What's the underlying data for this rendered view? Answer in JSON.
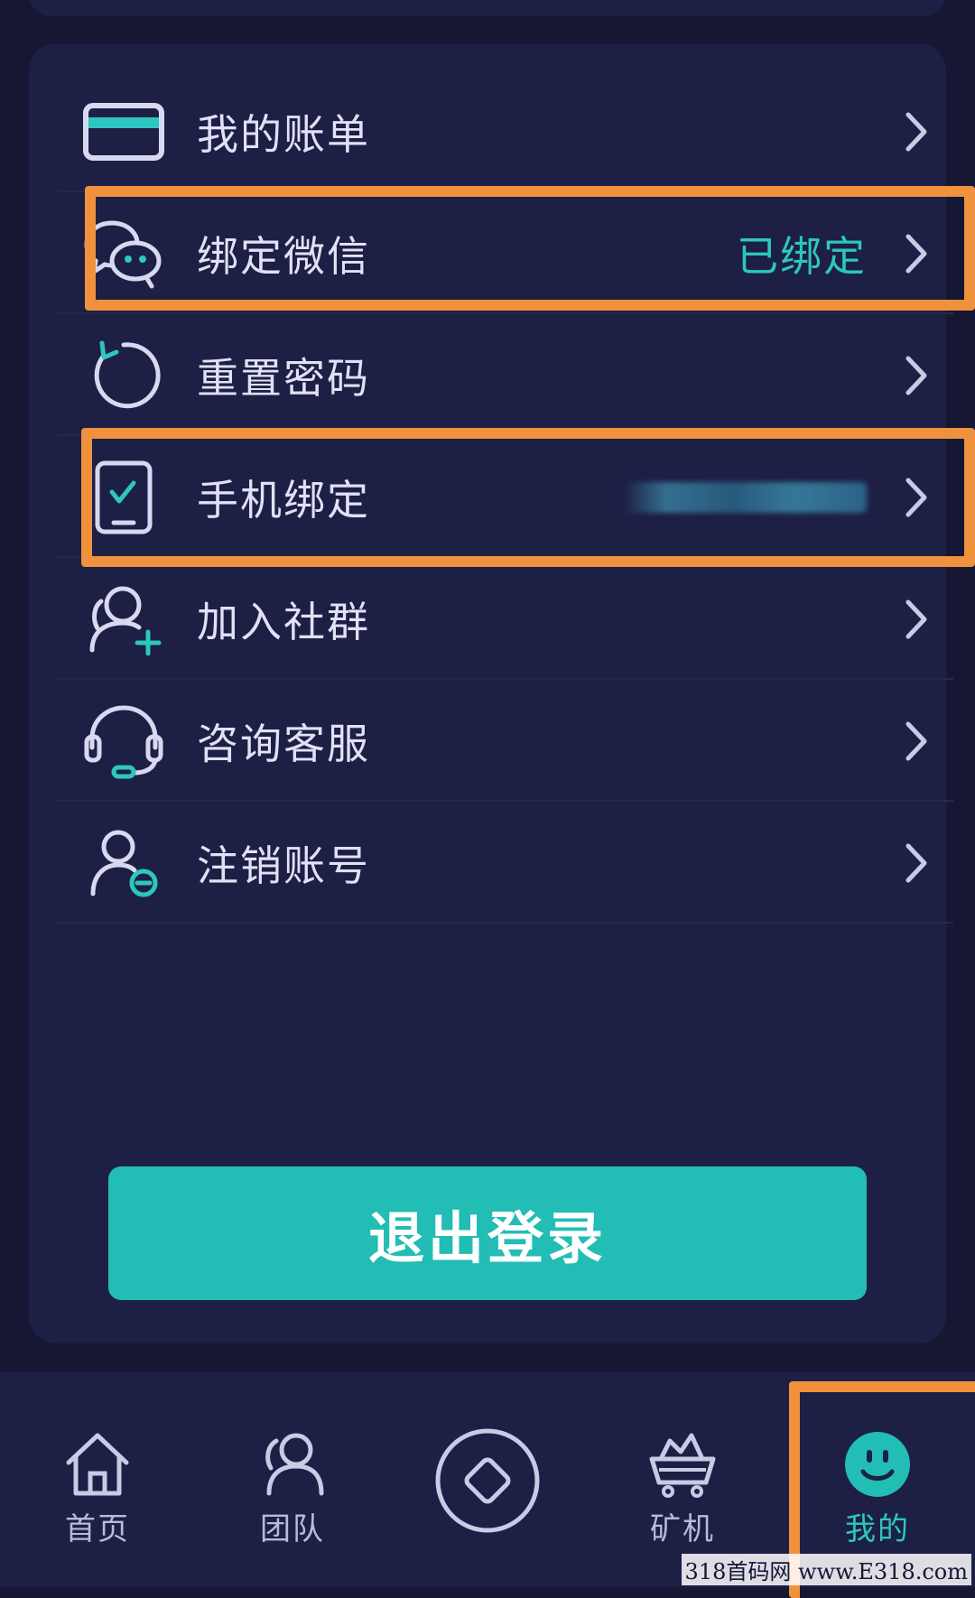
{
  "menu": {
    "items": [
      {
        "label": "我的账单",
        "value": "",
        "icon": "bill-card-icon"
      },
      {
        "label": "绑定微信",
        "value": "已绑定",
        "icon": "wechat-icon"
      },
      {
        "label": "重置密码",
        "value": "",
        "icon": "reset-icon"
      },
      {
        "label": "手机绑定",
        "value": "",
        "icon": "phone-icon"
      },
      {
        "label": "加入社群",
        "value": "",
        "icon": "add-user-icon"
      },
      {
        "label": "咨询客服",
        "value": "",
        "icon": "headset-icon"
      },
      {
        "label": "注销账号",
        "value": "",
        "icon": "remove-user-icon"
      }
    ]
  },
  "logout_label": "退出登录",
  "tabbar": {
    "tabs": [
      {
        "label": "首页",
        "icon": "home-icon"
      },
      {
        "label": "团队",
        "icon": "team-icon"
      },
      {
        "label": "",
        "icon": "center-diamond-icon"
      },
      {
        "label": "矿机",
        "icon": "miner-icon"
      },
      {
        "label": "我的",
        "icon": "smiley-icon",
        "active": true
      }
    ]
  },
  "watermark": "318首码网 www.E318.com",
  "colors": {
    "background": "#151733",
    "panel": "#1d1f45",
    "accent": "#22bdb5",
    "highlight": "#f0913d"
  }
}
